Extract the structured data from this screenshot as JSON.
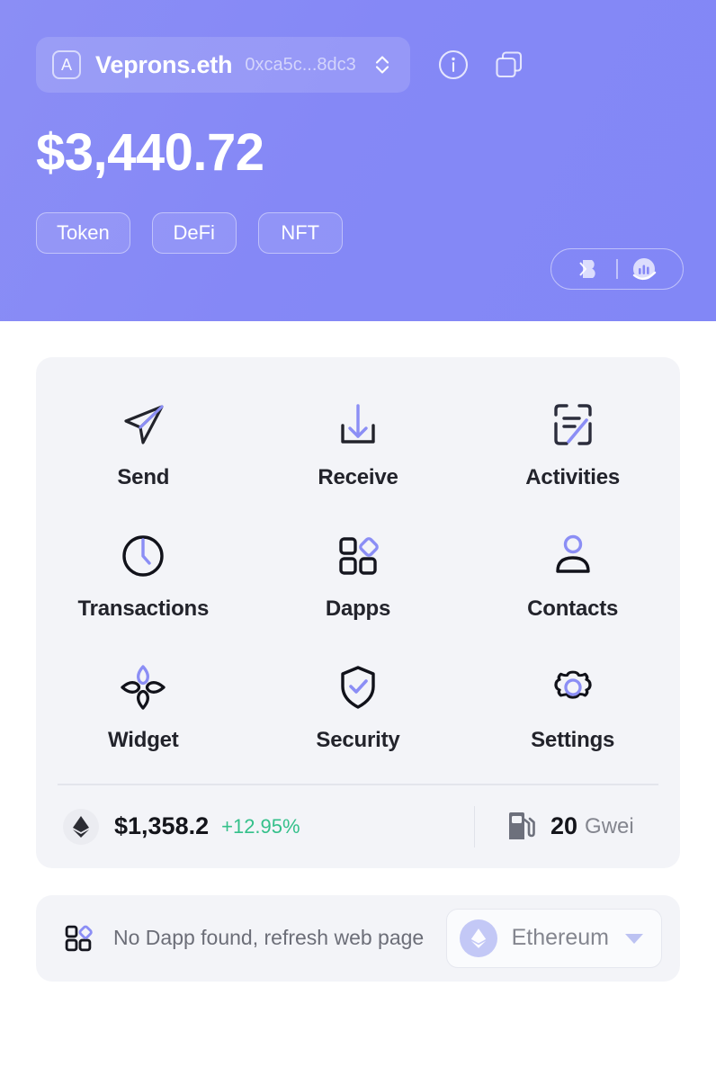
{
  "header": {
    "account": {
      "avatar_letter": "A",
      "name": "Veprons.eth",
      "address": "0xca5c...8dc3",
      "selector_icon": "chevron-up-down-icon"
    },
    "info_icon": "info-circle-icon",
    "copy_icon": "copy-windows-icon",
    "balance": "$3,440.72",
    "tabs": [
      {
        "label": "Token"
      },
      {
        "label": "DeFi"
      },
      {
        "label": "NFT"
      }
    ],
    "brand_pill": {
      "left_icon": "b-logo-icon",
      "right_icon": "chart-globe-icon"
    },
    "gradient_from": "#8b8ef5",
    "gradient_to": "#8287f6"
  },
  "main": {
    "actions": [
      {
        "label": "Send",
        "icon": "send-paper-plane-icon"
      },
      {
        "label": "Receive",
        "icon": "download-tray-icon"
      },
      {
        "label": "Activities",
        "icon": "document-pen-icon"
      },
      {
        "label": "Transactions",
        "icon": "clock-icon"
      },
      {
        "label": "Dapps",
        "icon": "grid-diamond-icon"
      },
      {
        "label": "Contacts",
        "icon": "person-icon"
      },
      {
        "label": "Widget",
        "icon": "four-petals-icon"
      },
      {
        "label": "Security",
        "icon": "shield-check-icon"
      },
      {
        "label": "Settings",
        "icon": "gear-icon"
      }
    ],
    "price_bar": {
      "coin_icon": "ethereum-diamond-icon",
      "price": "$1,358.2",
      "change": "+12.95%",
      "change_color": "#34c08a",
      "gas_icon": "gas-pump-icon",
      "gas_value": "20",
      "gas_unit": "Gwei"
    }
  },
  "dapp_bar": {
    "icon": "grid-diamond-icon",
    "message": "No Dapp found, refresh web page",
    "network": {
      "icon": "ethereum-diamond-icon",
      "name": "Ethereum",
      "caret": "caret-down-icon"
    }
  },
  "colors": {
    "accent_purple": "#8b8ef5",
    "card_bg": "#f3f4f8",
    "ink": "#22232b",
    "muted": "#84868f",
    "green": "#34c08a"
  }
}
